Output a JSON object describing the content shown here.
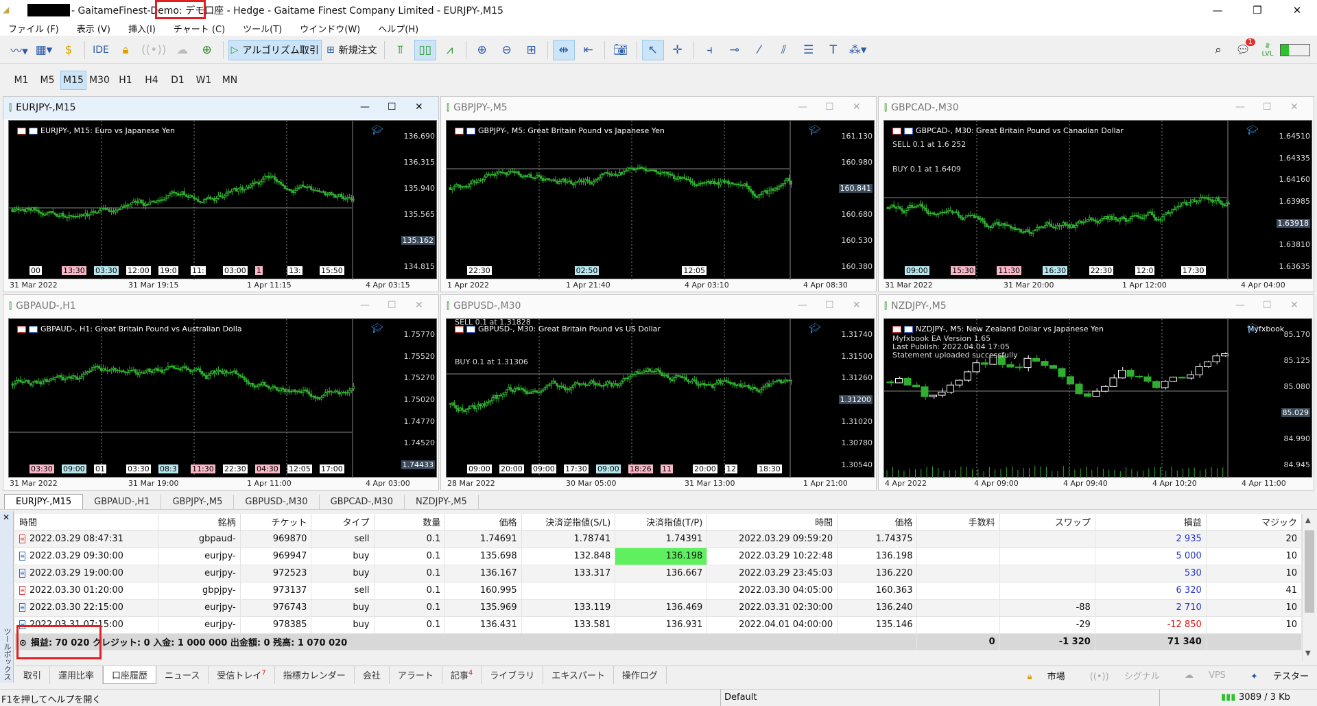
{
  "title": {
    "redacted": "",
    "text": "- GaitameFinest-Demo: デモ口座 - Hedge - Gaitame Finest Company Limited - EURJPY-,M15"
  },
  "menu": [
    "ファイル (F)",
    "表示 (V)",
    "挿入(I)",
    "チャート (C)",
    "ツール(T)",
    "ウインドウ(W)",
    "ヘルプ(H)"
  ],
  "toolbar": {
    "ide": "IDE",
    "algo": "アルゴリズム取引",
    "neworder": "新規注文",
    "notif_count": "1",
    "lvl": "LVL"
  },
  "timeframes": [
    "M1",
    "M5",
    "M15",
    "M30",
    "H1",
    "H4",
    "D1",
    "W1",
    "MN"
  ],
  "active_timeframe": "M15",
  "charts": [
    {
      "win": "EURJPY-,M15",
      "label": "EURJPY-, M15:  Euro vs Japanese Yen",
      "y": [
        "136.690",
        "136.315",
        "135.940",
        "135.565",
        "135.162",
        "134.815"
      ],
      "x": [
        "31 Mar 2022",
        "31 Mar 19:15",
        "1 Apr 11:15",
        "4 Apr 03:15"
      ],
      "tl": [
        [
          "00",
          "w"
        ],
        [
          "13:30",
          "p"
        ],
        [
          "03:30",
          "c"
        ],
        [
          "12:00",
          "w"
        ],
        [
          "19:0",
          "w"
        ],
        [
          "11:",
          "w"
        ],
        [
          "03:00",
          "w"
        ],
        [
          "1",
          "p"
        ],
        [
          "13:",
          "w"
        ],
        [
          "15:50",
          "w"
        ]
      ],
      "ann": []
    },
    {
      "win": "GBPJPY-,M5",
      "label": "GBPJPY-, M5:  Great Britain Pound vs Japanese Yen",
      "y": [
        "161.130",
        "160.980",
        "160.841",
        "160.680",
        "160.530",
        "160.380"
      ],
      "x": [
        "1 Apr 2022",
        "1 Apr 21:40",
        "4 Apr 03:10",
        "4 Apr 08:30"
      ],
      "tl": [
        [
          "22:30",
          "w"
        ],
        [
          "02:50",
          "c"
        ],
        [
          "12:05",
          "w"
        ]
      ],
      "ann": []
    },
    {
      "win": "GBPCAD-,M30",
      "label": "GBPCAD-, M30:  Great Britain Pound vs Canadian Dollar",
      "y": [
        "1.64510",
        "1.64335",
        "1.64160",
        "1.63985",
        "1.63918",
        "1.63810",
        "1.63635"
      ],
      "x": [
        "31 Mar 2022",
        "31 Mar 20:00",
        "1 Apr 12:00",
        "4 Apr 04:00"
      ],
      "tl": [
        [
          "09:00",
          "c"
        ],
        [
          "15:30",
          "p"
        ],
        [
          "11:30",
          "p"
        ],
        [
          "16:30",
          "c"
        ],
        [
          "22:30",
          "w"
        ],
        [
          "12:0",
          "w"
        ],
        [
          "17:30",
          "w"
        ]
      ],
      "ann": [
        "SELL 0.1 at 1.6 252",
        "BUY 0.1 at 1.6409"
      ]
    },
    {
      "win": "GBPAUD-,H1",
      "label": "GBPAUD-, H1:  Great Britain Pound vs Australian Dolla",
      "y": [
        "1.75770",
        "1.75520",
        "1.75270",
        "1.75020",
        "1.74770",
        "1.74520",
        "1.74433"
      ],
      "x": [
        "31 Mar 2022",
        "31 Mar 19:00",
        "1 Apr 11:00",
        "4 Apr 03:00"
      ],
      "tl": [
        [
          "03:30",
          "p"
        ],
        [
          "09:00",
          "c"
        ],
        [
          "01",
          "w"
        ],
        [
          "03:30",
          "w"
        ],
        [
          "08:3",
          "c"
        ],
        [
          "11:30",
          "p"
        ],
        [
          "22:30",
          "w"
        ],
        [
          "04:30",
          "p"
        ],
        [
          "12:05",
          "w"
        ],
        [
          "17:00",
          "w"
        ]
      ],
      "ann": []
    },
    {
      "win": "GBPUSD-,M30",
      "label": "GBPUSD-, M30:  Great Britain Pound vs US Dollar",
      "y": [
        "1.31740",
        "1.31500",
        "1.31260",
        "1.31200",
        "1.31020",
        "1.30780",
        "1.30540"
      ],
      "x": [
        "28 Mar 2022",
        "30 Mar 05:00",
        "31 Mar 13:00",
        "1 Apr 21:00"
      ],
      "tl": [
        [
          "09:00",
          "w"
        ],
        [
          "20:00",
          "w"
        ],
        [
          "09:00",
          "w"
        ],
        [
          "17:30",
          "w"
        ],
        [
          "09:00",
          "c"
        ],
        [
          "18:26",
          "p"
        ],
        [
          "11",
          "p"
        ],
        [
          "20:00",
          "w"
        ],
        [
          "12",
          "w"
        ],
        [
          "18:30",
          "w"
        ]
      ],
      "ann": [
        "SELL 0.1 at 1.31828",
        "BUY 0.1 at 1.31306"
      ]
    },
    {
      "win": "NZDJPY-,M5",
      "label": "NZDJPY-, M5:  New Zealand Dollar vs Japanese Yen",
      "brand": "Myfxbook",
      "y": [
        "85.170",
        "85.125",
        "85.080",
        "85.029",
        "84.990",
        "84.945"
      ],
      "x": [
        "4 Apr 2022",
        "4 Apr 09:00",
        "4 Apr 09:40",
        "4 Apr 10:20",
        "4 Apr 11:00"
      ],
      "tl": [],
      "ann": [
        "Myfxbook EA Version 1.65",
        "Last Publish: 2022.04.04 17:05",
        "Statement uploaded successfully"
      ]
    }
  ],
  "chart_tabs": [
    "EURJPY-,M15",
    "GBPAUD-,H1",
    "GBPJPY-,M5",
    "GBPUSD-,M30",
    "GBPCAD-,M30",
    "NZDJPY-,M5"
  ],
  "table": {
    "headers": [
      "時間",
      "銘柄",
      "チケット",
      "タイプ",
      "数量",
      "価格",
      "決済逆指値(S/L)",
      "決済指値(T/P)",
      "時間",
      "価格",
      "手数料",
      "スワップ",
      "損益",
      "マジック"
    ],
    "rows": [
      [
        "2022.03.29 08:47:31",
        "gbpaud-",
        "969870",
        "sell",
        "0.1",
        "1.74691",
        "1.78741",
        "1.74391",
        "2022.03.29 09:59:20",
        "1.74375",
        "",
        "",
        "2 935",
        "20"
      ],
      [
        "2022.03.29 09:30:00",
        "eurjpy-",
        "969947",
        "buy",
        "0.1",
        "135.698",
        "132.848",
        "136.198",
        "2022.03.29 10:22:48",
        "136.198",
        "",
        "",
        "5 000",
        "10"
      ],
      [
        "2022.03.29 19:00:00",
        "eurjpy-",
        "972523",
        "buy",
        "0.1",
        "136.167",
        "133.317",
        "136.667",
        "2022.03.29 23:45:03",
        "136.220",
        "",
        "",
        "530",
        "10"
      ],
      [
        "2022.03.30 01:20:00",
        "gbpjpy-",
        "973137",
        "sell",
        "0.1",
        "160.995",
        "",
        "",
        "2022.03.30 04:05:00",
        "160.363",
        "",
        "",
        "6 320",
        "41"
      ],
      [
        "2022.03.30 22:15:00",
        "eurjpy-",
        "976743",
        "buy",
        "0.1",
        "135.969",
        "133.119",
        "136.469",
        "2022.03.31 02:30:00",
        "136.240",
        "",
        "-88",
        "2 710",
        "10"
      ],
      [
        "2022.03.31 07:15:00",
        "eurjpy-",
        "978385",
        "buy",
        "0.1",
        "136.431",
        "133.581",
        "136.931",
        "2022.04.01 04:00:00",
        "135.146",
        "",
        "-29",
        "-12 850",
        "10"
      ]
    ],
    "summary": {
      "text": "損益: 70 020  クレジット: 0  入金: 1 000 000  出金額: 0  残高: 1 070 020",
      "commission": "0",
      "swap": "-1 320",
      "profit": "71 340"
    }
  },
  "toolbox_label": "ツールボックス",
  "bottom_tabs": [
    {
      "l": "取引",
      "b": ""
    },
    {
      "l": "運用比率",
      "b": ""
    },
    {
      "l": "口座履歴",
      "b": ""
    },
    {
      "l": "ニュース",
      "b": ""
    },
    {
      "l": "受信トレイ",
      "b": "7"
    },
    {
      "l": "指標カレンダー",
      "b": ""
    },
    {
      "l": "会社",
      "b": ""
    },
    {
      "l": "アラート",
      "b": ""
    },
    {
      "l": "記事",
      "b": "4"
    },
    {
      "l": "ライブラリ",
      "b": ""
    },
    {
      "l": "エキスパート",
      "b": ""
    },
    {
      "l": "操作ログ",
      "b": ""
    }
  ],
  "right_tabs": [
    "市場",
    "シグナル",
    "VPS",
    "テスター"
  ],
  "status": {
    "help": "F1を押してヘルプを開く",
    "profile": "Default",
    "traffic": "3089 / 3 Kb"
  },
  "colors": {
    "candle": "#2fae2f",
    "accent": "#cce4f7",
    "tp_highlight": "#5ef05e",
    "annotation_box": "#e02020"
  }
}
